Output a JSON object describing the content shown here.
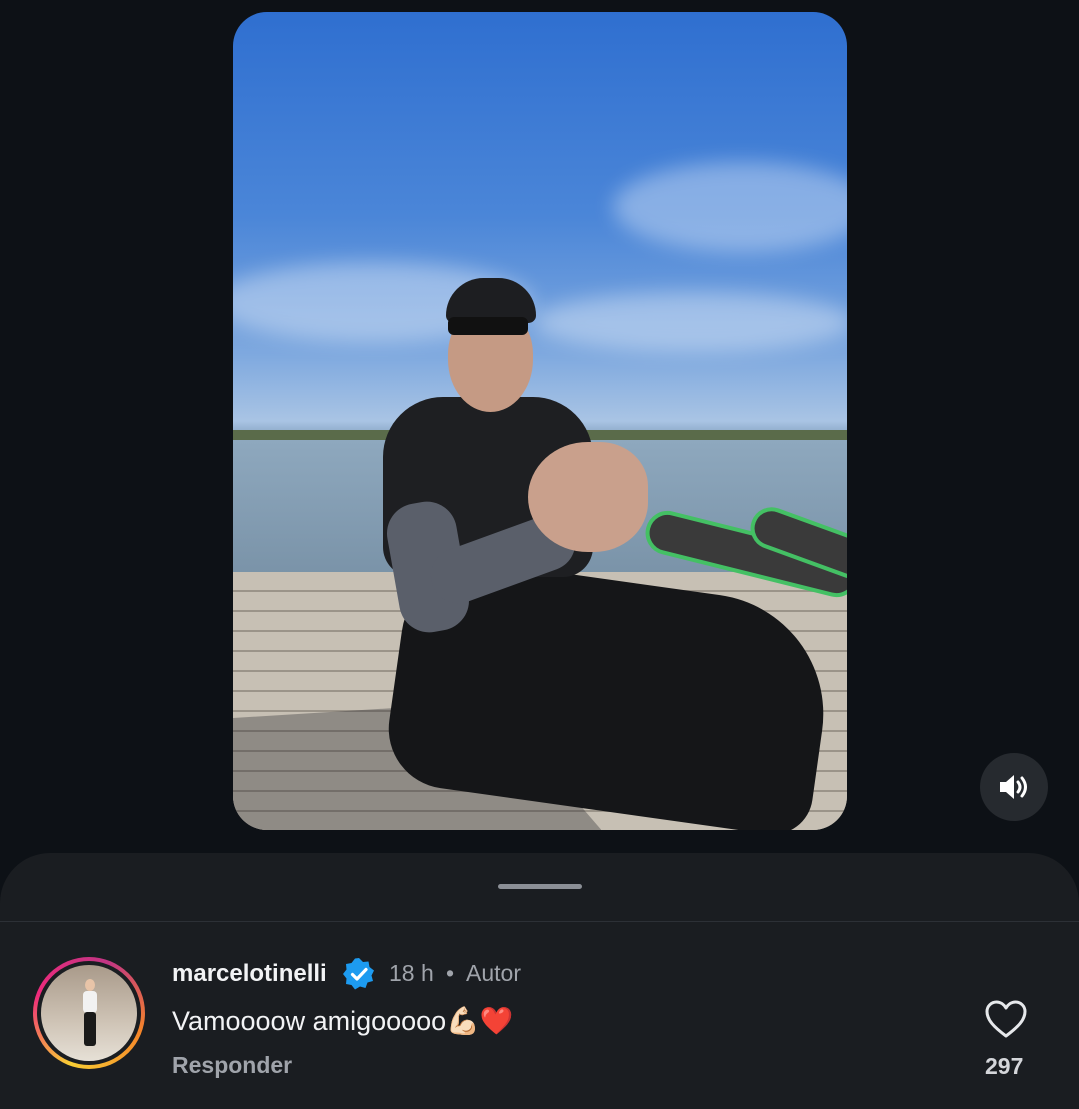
{
  "video": {
    "sound_icon": "speaker-volume-icon"
  },
  "comment": {
    "username": "marcelotinelli",
    "verified_icon": "verified-badge-icon",
    "time": "18 h",
    "separator": "•",
    "author_label": "Autor",
    "text": "Vamoooow amigooooo💪🏻❤️",
    "reply_label": "Responder",
    "like_icon": "heart-outline-icon",
    "like_count": "297"
  },
  "colors": {
    "background": "#0d1116",
    "sheet": "#1a1d21",
    "verified": "#1d9bf0",
    "secondary_text": "#a0a4ab"
  }
}
